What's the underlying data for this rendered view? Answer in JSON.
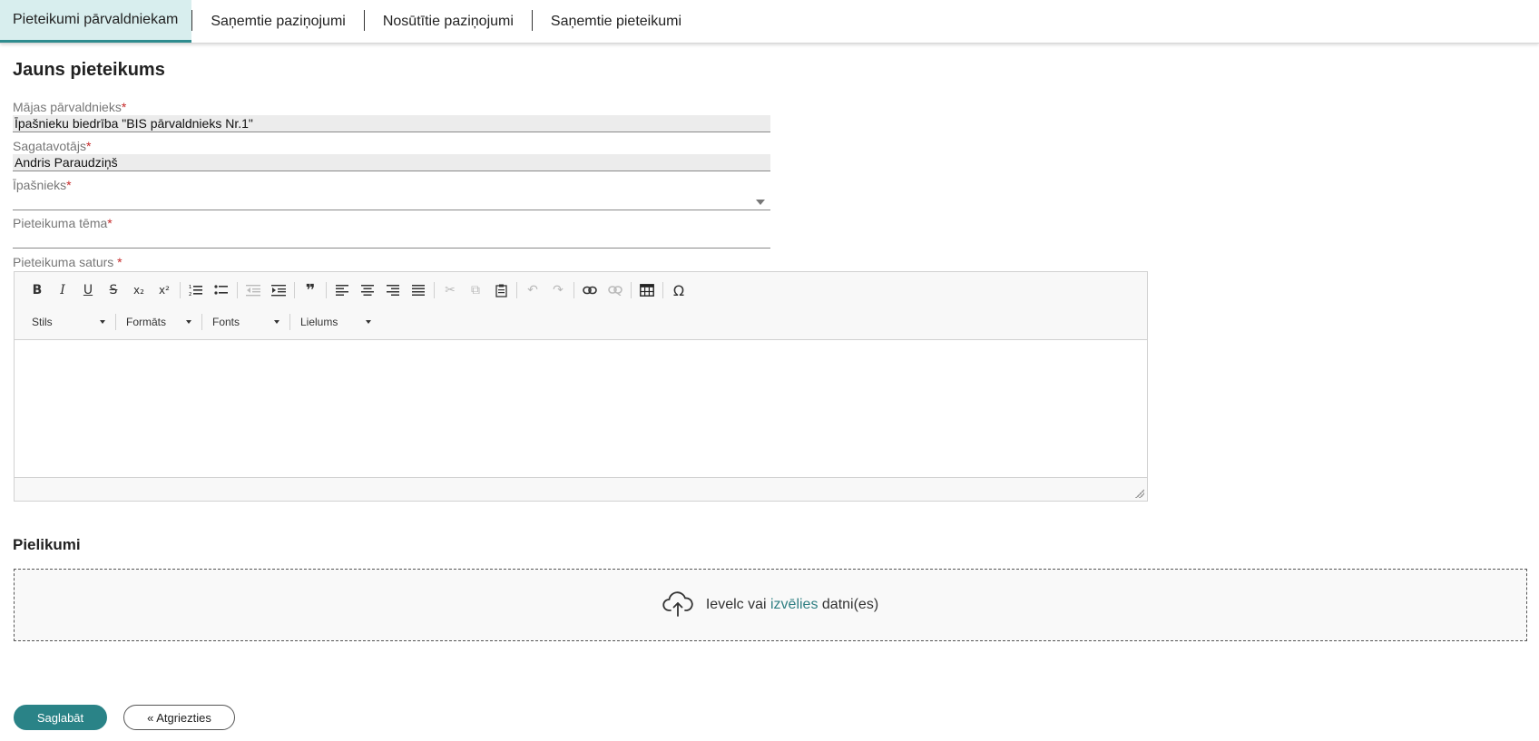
{
  "tabs": [
    {
      "label": "Pieteikumi pārvaldniekam",
      "active": true
    },
    {
      "label": "Saņemtie paziņojumi",
      "active": false
    },
    {
      "label": "Nosūtītie paziņojumi",
      "active": false
    },
    {
      "label": "Saņemtie pieteikumi",
      "active": false
    }
  ],
  "form": {
    "title": "Jauns pieteikums",
    "required_mark": "*",
    "manager": {
      "label": "Mājas pārvaldnieks",
      "value": "Īpašnieku biedrība \"BIS pārvaldnieks Nr.1\""
    },
    "preparer": {
      "label": "Sagatavotājs",
      "value": "Andris Paraudziņš"
    },
    "owner": {
      "label": "Īpašnieks",
      "value": ""
    },
    "subject": {
      "label": "Pieteikuma tēma",
      "value": ""
    },
    "content": {
      "label": "Pieteikuma saturs"
    }
  },
  "editor": {
    "toolbar_icons": {
      "bold": "B",
      "italic": "I",
      "underline": "U",
      "strike": "S",
      "subscript": "x₂",
      "superscript": "x²",
      "numbered_list": "⒈",
      "bullet_list": "•≡",
      "outdent": "⇤",
      "indent": "⇥",
      "blockquote": "❞",
      "align_left": "≡",
      "align_center": "≡",
      "align_right": "≡",
      "justify": "≡",
      "cut": "✂",
      "copy": "⧉",
      "paste": "📋",
      "undo": "↶",
      "redo": "↷",
      "link": "🔗",
      "unlink": "⛓",
      "table": "▦",
      "special_char": "Ω"
    },
    "combos": {
      "style": "Stils",
      "format": "Formāts",
      "font": "Fonts",
      "size": "Lielums"
    },
    "body_text": ""
  },
  "attachments": {
    "title": "Pielikumi",
    "drop_prefix": "Ievelc vai ",
    "drop_link": "izvēlies",
    "drop_suffix": " datni(es)",
    "icon": "cloud-upload-icon"
  },
  "buttons": {
    "save": "Saglabāt",
    "back": "« Atgriezties"
  },
  "colors": {
    "accent": "#2a8387",
    "tab_active_bg": "#d8eeee",
    "required": "#c62828"
  }
}
